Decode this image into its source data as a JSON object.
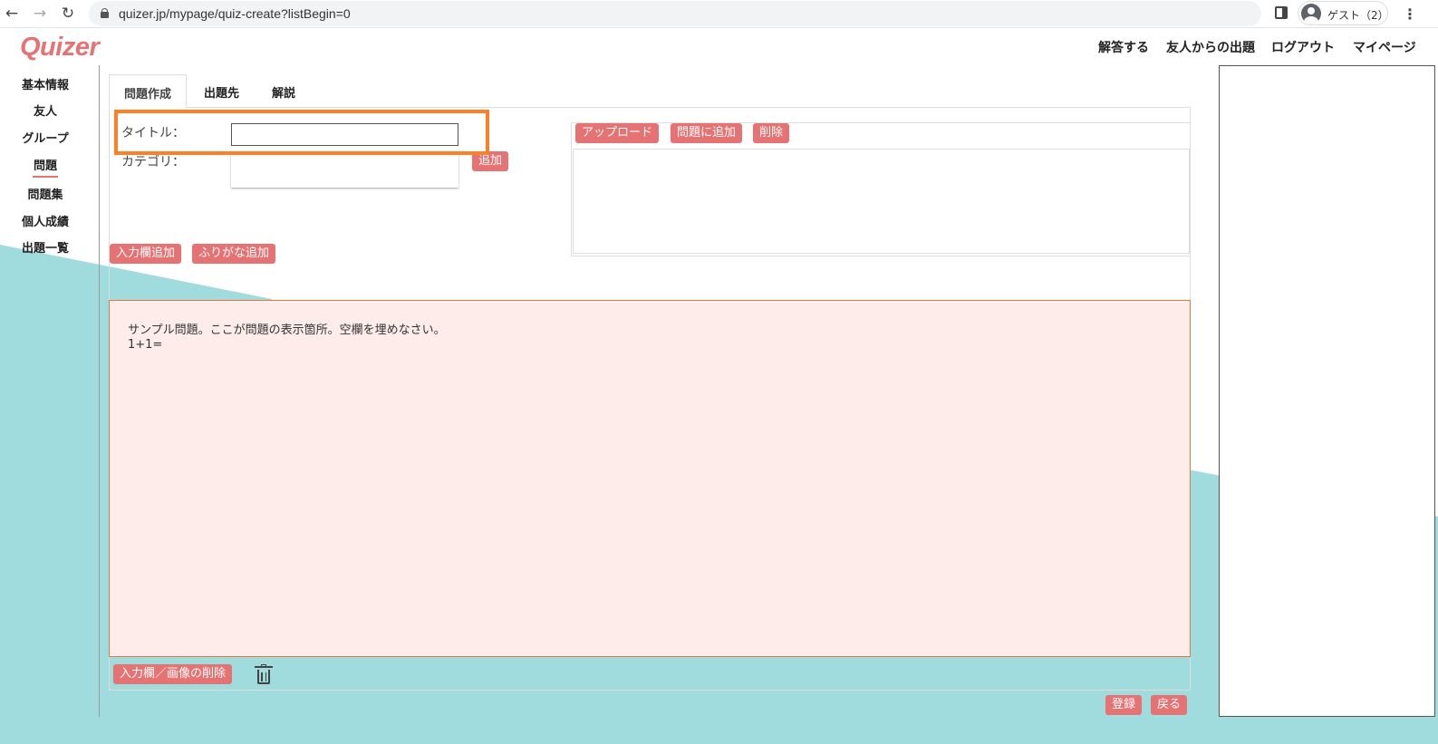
{
  "browser": {
    "url": "quizer.jp/mypage/quiz-create?listBegin=0",
    "profile_label": "ゲスト（2）",
    "icons": [
      "back-arrow-icon",
      "forward-arrow-icon",
      "reload-icon",
      "lock-icon",
      "side-panel-icon",
      "avatar-icon",
      "more-menu-icon"
    ]
  },
  "site": {
    "logo": "Quizer",
    "brand_color": "#e57373",
    "accent_teal": "#a0dcdd"
  },
  "topnav": {
    "answer": "解答する",
    "from_friends": "友人からの出題",
    "logout": "ログアウト",
    "mypage": "マイページ"
  },
  "sidebar": {
    "items": [
      {
        "label": "基本情報"
      },
      {
        "label": "友人"
      },
      {
        "label": "グループ"
      },
      {
        "label": "問題"
      },
      {
        "label": "問題集"
      },
      {
        "label": "個人成績"
      },
      {
        "label": "出題一覧"
      }
    ],
    "active": "問題"
  },
  "tabs": {
    "create": "問題作成",
    "destination": "出題先",
    "explanation": "解説"
  },
  "form": {
    "title_label": "タイトル：",
    "title_value": "",
    "category_label": "カテゴリ：",
    "add_category_button": "追加",
    "add_input_button": "入力欄追加",
    "add_furigana_button": "ふりがな追加"
  },
  "upload": {
    "upload_button": "アップロード",
    "add_to_question_button": "問題に追加",
    "delete_button": "削除"
  },
  "question": {
    "line1": "サンプル問題。ここが問題の表示箇所。空欄を埋めなさい。",
    "line2": "1+1="
  },
  "footer": {
    "delete_input_image_button": "入力欄／画像の削除",
    "register_button": "登録",
    "back_button": "戻る"
  }
}
